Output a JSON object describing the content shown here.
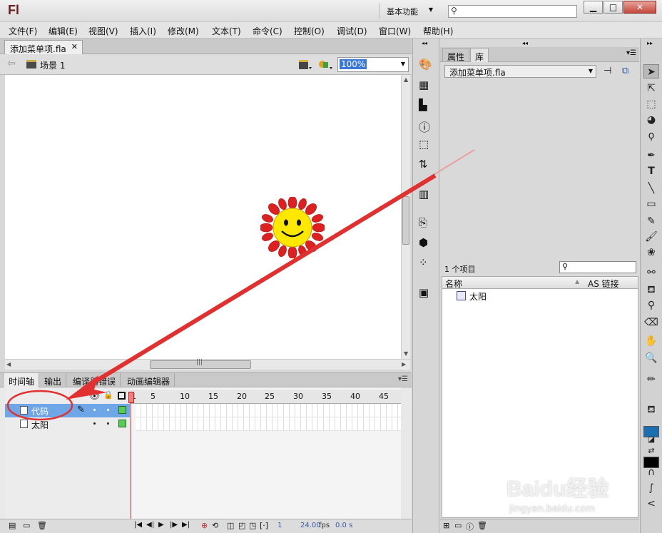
{
  "app": {
    "logo": "Fl",
    "workspace": "基本功能"
  },
  "menu": [
    "文件(F)",
    "编辑(E)",
    "视图(V)",
    "插入(I)",
    "修改(M)",
    "文本(T)",
    "命令(C)",
    "控制(O)",
    "调试(D)",
    "窗口(W)",
    "帮助(H)"
  ],
  "document": {
    "tab": "添加菜单项.fla",
    "scene": "场景 1",
    "zoom": "100%"
  },
  "timeline": {
    "tabs": [
      "时间轴",
      "输出",
      "编译器错误",
      "动画编辑器"
    ],
    "ruler": [
      "1",
      "5",
      "10",
      "15",
      "20",
      "25",
      "30",
      "35",
      "40",
      "45"
    ],
    "layers": [
      {
        "name": "代码",
        "selected": true
      },
      {
        "name": "太阳",
        "selected": false
      }
    ],
    "current_frame": "1",
    "fps": "24.00",
    "fps_unit": "fps",
    "time": "0.0 s"
  },
  "library": {
    "tabs": [
      "属性",
      "库"
    ],
    "file": "添加菜单项.fla",
    "count": "1 个项目",
    "columns": {
      "name": "名称",
      "linkage": "AS 链接"
    },
    "items": [
      {
        "name": "太阳",
        "icon": "graphic-symbol-icon"
      }
    ]
  },
  "watermark": {
    "brand": "Baidu经验",
    "site": "jingyan.baidu.com"
  },
  "colors": {
    "stroke": "#1a6fb0",
    "fill": "#000000",
    "annotation": "#e03030",
    "selected_layer": "#6ea6e8"
  }
}
